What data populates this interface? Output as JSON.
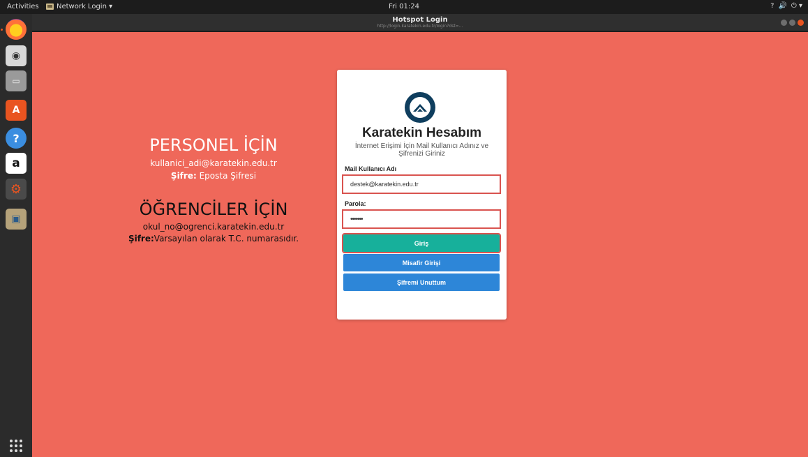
{
  "topbar": {
    "activities": "Activities",
    "app_menu": "Network Login ▾",
    "clock": "Fri 01:24",
    "tray": [
      "?",
      "🔊",
      "⏻ ▾"
    ]
  },
  "window": {
    "title": "Hotspot Login",
    "url": "http://login.karatekin.edu.tr/login?dst=..."
  },
  "dock": {
    "items": [
      "firefox-icon",
      "rhythmbox-icon",
      "files-icon",
      "software-center-icon",
      "help-icon",
      "amazon-icon",
      "settings-icon",
      "file-manager-icon"
    ]
  },
  "info": {
    "personel_title": "PERSONEL İÇİN",
    "personel_email": "kullanici_adi@karatekin.edu.tr",
    "personel_pw_label": "Şifre:",
    "personel_pw_value": " Eposta Şifresi",
    "ogrenci_title": "ÖĞRENCİLER İÇİN",
    "ogrenci_email": "okul_no@ogrenci.karatekin.edu.tr",
    "ogrenci_pw_label": "Şifre:",
    "ogrenci_pw_value": "Varsayılan olarak T.C. numarasıdır."
  },
  "login": {
    "title": "Karatekin Hesabım",
    "subtitle": "İnternet Erişimi İçin Mail Kullanıcı Adınız ve Şifrenizi Giriniz",
    "user_label": "Mail Kullanıcı Adı",
    "user_value": "destek@karatekin.edu.tr",
    "pass_label": "Parola:",
    "pass_value": "•••••••",
    "login_button": "Giriş",
    "guest_button": "Misafir Girişi",
    "forgot_button": "Şifremi Unuttum"
  },
  "colors": {
    "page_bg": "#ef685a",
    "primary_green": "#17b09b",
    "primary_blue": "#2d86d8",
    "error_border": "#d9534f"
  }
}
